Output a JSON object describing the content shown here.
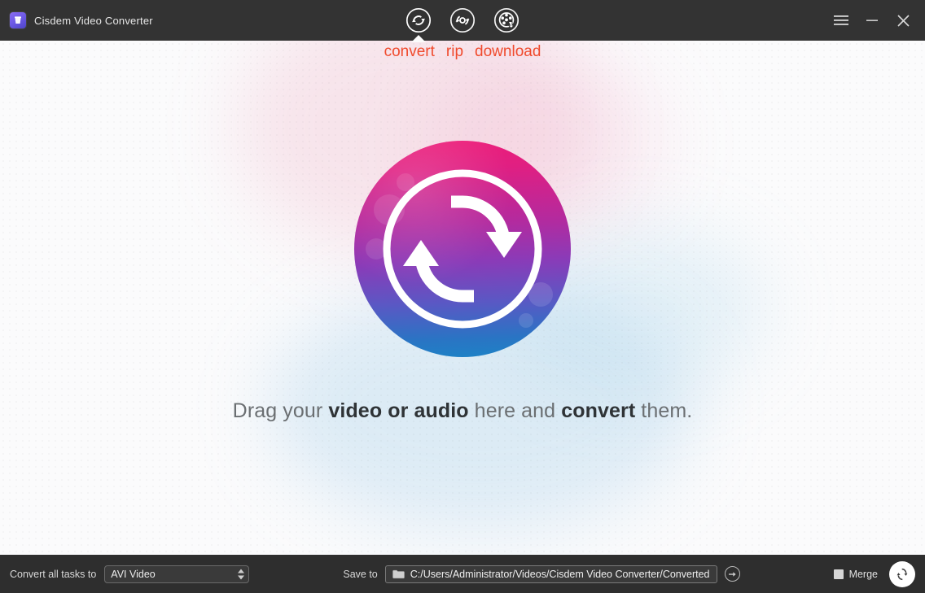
{
  "window": {
    "title": "Cisdem Video Converter",
    "app_icon": "cisdem-logo-icon",
    "controls": {
      "menu": "menu-icon",
      "minimize": "minimize-icon",
      "close": "close-icon"
    }
  },
  "nav": {
    "items": [
      {
        "id": "convert",
        "label": "convert",
        "icon": "convert-icon",
        "active": true
      },
      {
        "id": "rip",
        "label": "rip",
        "icon": "rip-disc-icon",
        "active": false
      },
      {
        "id": "download",
        "label": "download",
        "icon": "film-download-icon",
        "active": false
      }
    ],
    "label_color": "#f04a2d"
  },
  "main": {
    "logo_icon": "convert-circle-logo",
    "drop_text": {
      "part1": "Drag your ",
      "bold1": "video or audio",
      "part2": " here and ",
      "bold2": "convert",
      "part3": " them."
    }
  },
  "bottom": {
    "convert_all_label": "Convert all tasks to",
    "format_value": "AVI Video",
    "save_to_label": "Save to",
    "save_path": "C:/Users/Administrator/Videos/Cisdem Video Converter/Converted",
    "folder_icon": "folder-icon",
    "go_icon": "arrow-right-icon",
    "merge_label": "Merge",
    "merge_checked": false,
    "start_icon": "convert-start-icon"
  },
  "colors": {
    "titlebar": "#333333",
    "bottombar": "#2e2e2e",
    "accent_orange": "#f04a2d",
    "logo_top": "#ed1e79",
    "logo_mid": "#8a3bb8",
    "logo_bottom": "#1c83c6",
    "canvas": "#fbfbfc"
  }
}
